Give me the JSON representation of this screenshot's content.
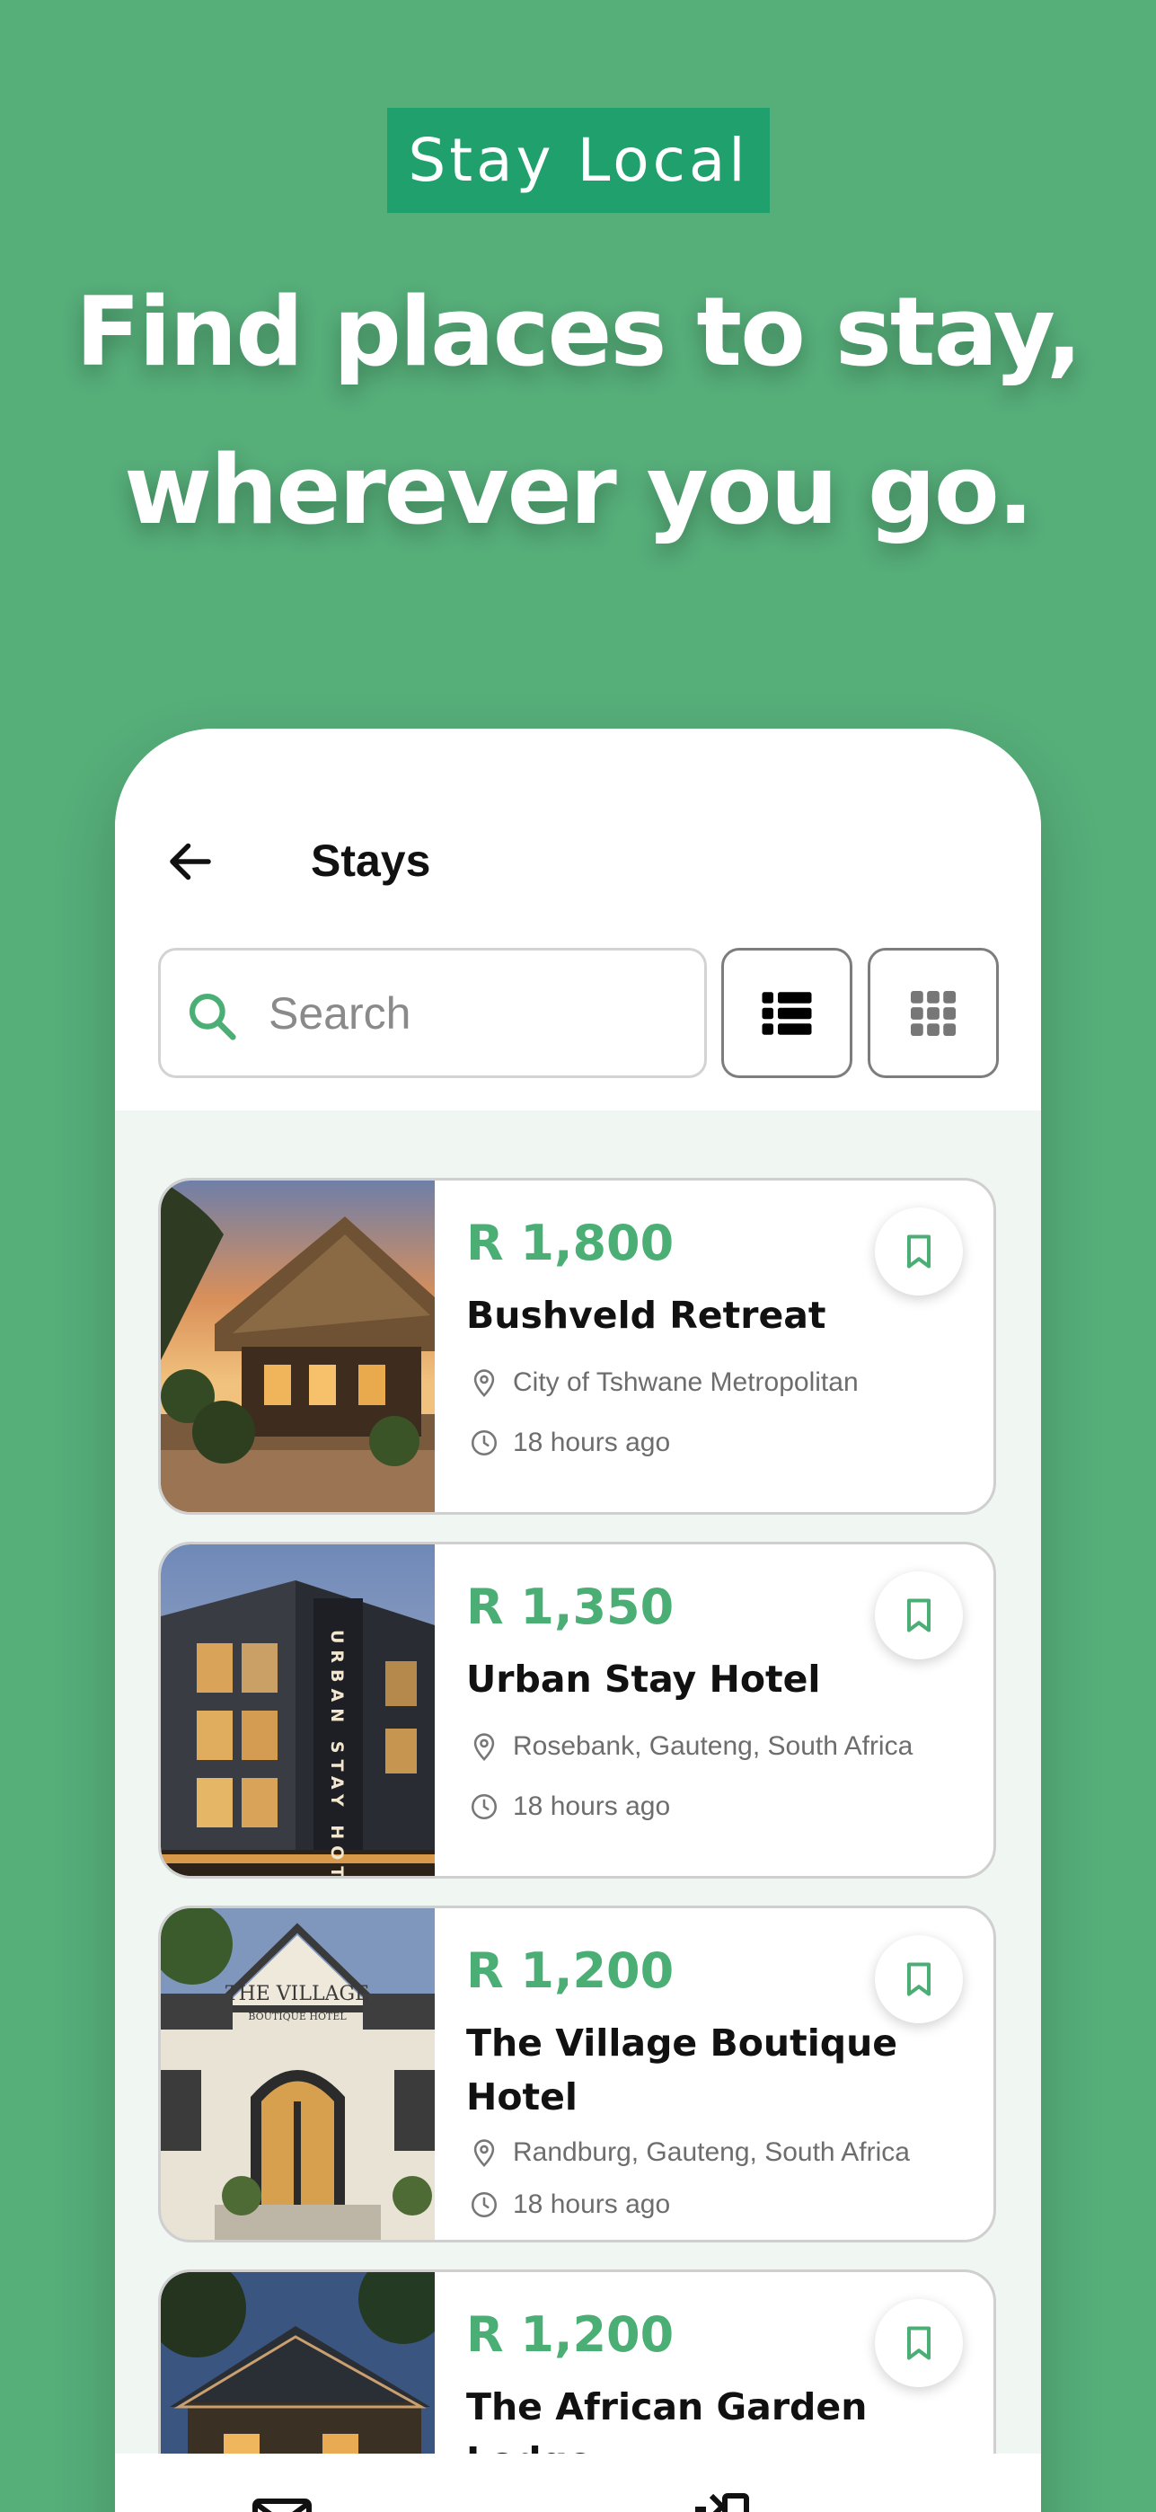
{
  "promo": {
    "badge": "Stay Local",
    "headline_line1": "Find places to stay,",
    "headline_line2": "wherever you go."
  },
  "screen": {
    "title": "Stays",
    "search_placeholder": "Search"
  },
  "listings": [
    {
      "price": "R 1,800",
      "name": "Bushveld Retreat",
      "location": "City of Tshwane Metropolitan",
      "time": "18 hours ago"
    },
    {
      "price": "R 1,350",
      "name": "Urban Stay Hotel",
      "location": "Rosebank, Gauteng, South Africa",
      "time": "18 hours ago"
    },
    {
      "price": "R 1,200",
      "name": "The Village Boutique Hotel",
      "location": "Randburg, Gauteng, South Africa",
      "time": "18 hours ago"
    },
    {
      "price": "R 1,200",
      "name": "The African Garden Lodge",
      "location": "",
      "time": ""
    }
  ],
  "image_text": {
    "urban_sign": "URBAN STAY HOTEL",
    "village_sign_1": "THE VILLAGE",
    "village_sign_2": "BOUTIQUE HOTEL"
  },
  "colors": {
    "background": "#56ae79",
    "badge": "#20a06c",
    "accent": "#4bae74",
    "panel": "#f0f7f2"
  },
  "icons": [
    "back-arrow-icon",
    "search-icon",
    "list-view-icon",
    "grid-view-icon",
    "bookmark-icon",
    "location-pin-icon",
    "clock-icon",
    "mail-icon",
    "share-icon"
  ]
}
